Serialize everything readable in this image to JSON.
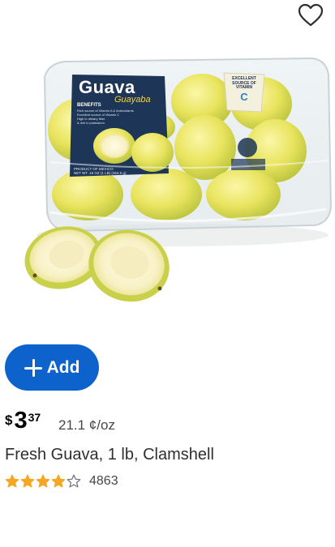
{
  "product": {
    "title": "Fresh Guava, 1 lb, Clamshell",
    "price": {
      "currency": "$",
      "dollars": "3",
      "cents": "37"
    },
    "unit_price": "21.1 ¢/oz",
    "rating": {
      "stars": 4,
      "max": 5,
      "review_count": "4863"
    },
    "add_label": "Add",
    "icons": {
      "favorite": "heart-outline-icon",
      "add": "plus-icon",
      "star": "star-icon"
    }
  },
  "package_label": {
    "title": "Guava",
    "subtitle": "Guayaba",
    "benefits_heading": "BENEFITS",
    "benefit_lines": [
      "Rich source of Vitamin A & Antioxidants",
      "Excellent source of Vitamin C",
      "High in dietary fiber",
      "& rich in potassium"
    ],
    "origin": [
      "PRODUCT OF MEXICO",
      "NET WT. 16 OZ (1 LB) (453.6 g)"
    ],
    "badge_lines": [
      "EXCELLENT",
      "SOURCE OF",
      "VITAMIN"
    ],
    "badge_letter": "C"
  },
  "colors": {
    "accent": "#0d62cc",
    "star": "#f5a623",
    "text": "#2e2f32",
    "label_navy": "#1d3557"
  }
}
